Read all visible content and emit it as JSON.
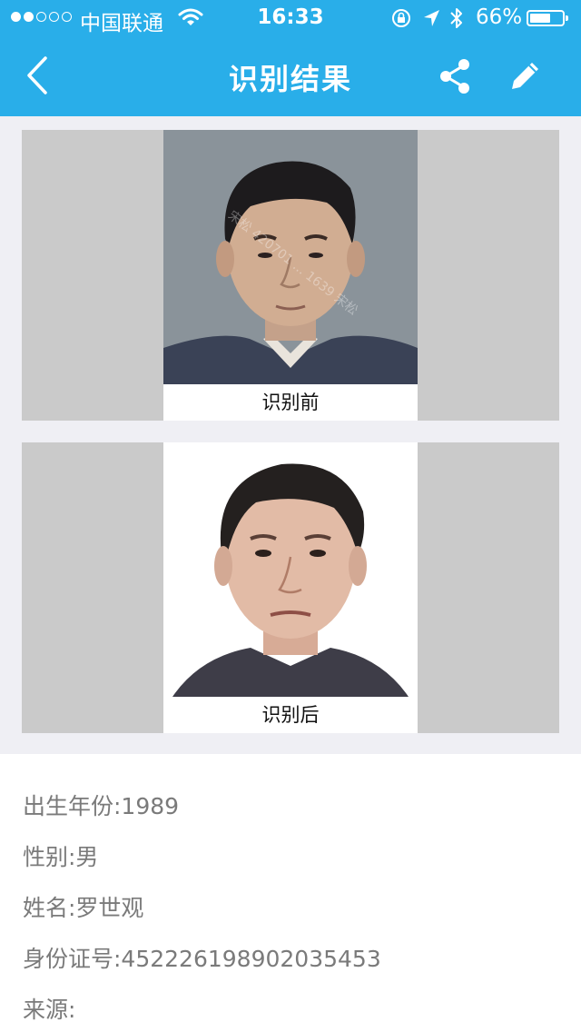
{
  "status_bar": {
    "carrier": "中国联通",
    "time": "16:33",
    "battery": "66%",
    "battery_level": 0.66
  },
  "nav": {
    "title": "识别结果"
  },
  "before": {
    "caption": "识别前",
    "watermark": "宋松 420701 ... 1639 宋松"
  },
  "after": {
    "caption": "识别后"
  },
  "info": {
    "birth_year": "出生年份:1989",
    "gender": "性别:男",
    "name": "姓名:罗世观",
    "id_number": "身份证号:452226198902035453",
    "source": "来源:"
  },
  "colors": {
    "accent": "#29aee9",
    "panel": "#cacaca",
    "text": "#7a7a7a"
  }
}
